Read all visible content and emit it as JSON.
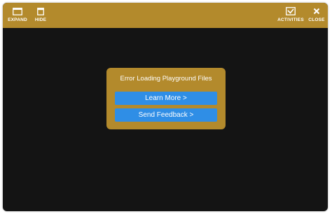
{
  "toolbar": {
    "expand": {
      "label": "EXPAND",
      "icon": "window-expand-icon"
    },
    "hide": {
      "label": "HIDE",
      "icon": "window-hide-icon"
    },
    "activities": {
      "label": "ACTIVITIES",
      "icon": "checkbox-activities-icon"
    },
    "close": {
      "label": "CLOSE",
      "icon": "close-icon"
    }
  },
  "dialog": {
    "title": "Error Loading Playground Files",
    "learn_more": "Learn More >",
    "send_feedback": "Send Feedback >"
  },
  "colors": {
    "accent": "#b38a2c",
    "background": "#141414",
    "button": "#2f8ee6",
    "text": "#ffffff"
  }
}
